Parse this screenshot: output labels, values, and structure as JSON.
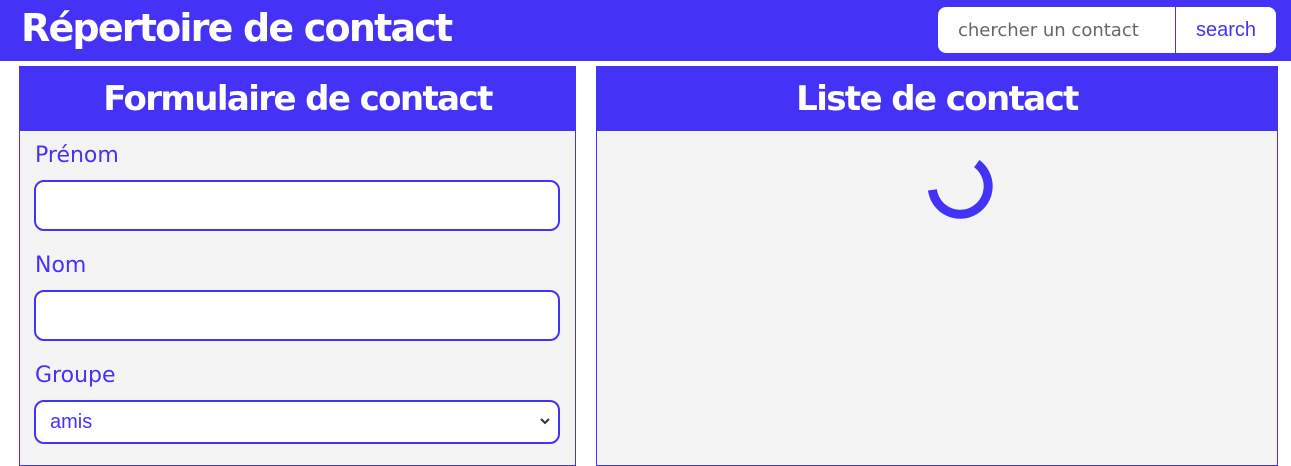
{
  "header": {
    "title": "Répertoire de contact",
    "search_placeholder": "chercher un contact",
    "search_value": "",
    "search_button_label": "search"
  },
  "form_panel": {
    "title": "Formulaire de contact",
    "fields": [
      {
        "label": "Prénom",
        "value": ""
      },
      {
        "label": "Nom",
        "value": ""
      }
    ],
    "group": {
      "label": "Groupe",
      "selected": "amis"
    }
  },
  "list_panel": {
    "title": "Liste de contact",
    "loading_icon": "spinner-icon"
  },
  "colors": {
    "accent": "#4433f7",
    "panel_bg": "#f4f4f4",
    "white": "#ffffff"
  }
}
